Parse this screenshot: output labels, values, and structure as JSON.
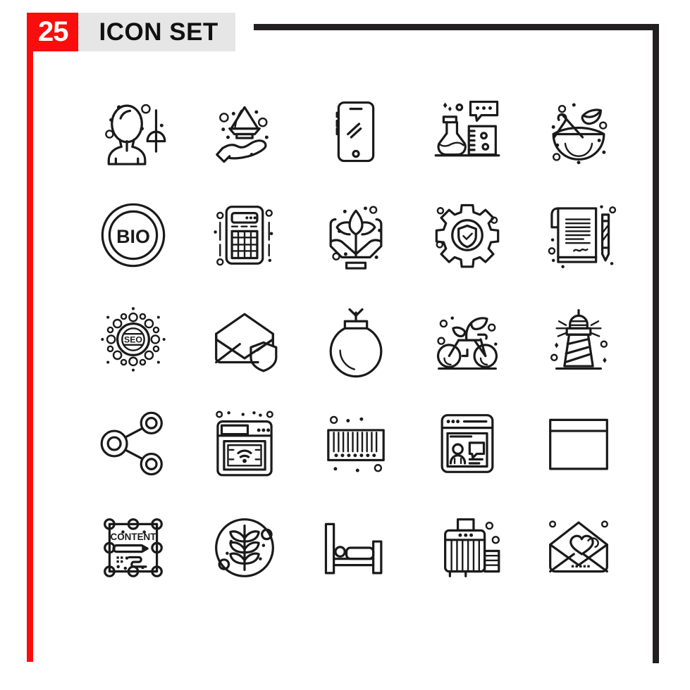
{
  "poster": {
    "count": "25",
    "title": "ICON SET",
    "accent_color": "#fb0d0d",
    "ink_color": "#231f20",
    "plate_color": "#e6e6e6",
    "background_color": "#ffffff",
    "grid_columns": 5,
    "grid_rows": 5,
    "total_icons": 25
  },
  "icons": [
    {
      "index": 1,
      "row": 1,
      "col": 1,
      "name": "user-desk-lamp-icon",
      "label": "User with desk lamp"
    },
    {
      "index": 2,
      "row": 1,
      "col": 2,
      "name": "hand-holding-gem-icon",
      "label": "Hand holding gem"
    },
    {
      "index": 3,
      "row": 1,
      "col": 3,
      "name": "smartphone-icon",
      "label": "Smartphone"
    },
    {
      "index": 4,
      "row": 1,
      "col": 4,
      "name": "lab-flask-beaker-chat-icon",
      "label": "Lab flask and beaker with chat bubble"
    },
    {
      "index": 5,
      "row": 1,
      "col": 5,
      "name": "mortar-pestle-herbs-icon",
      "label": "Mortar and pestle with herbs"
    },
    {
      "index": 6,
      "row": 2,
      "col": 1,
      "name": "bio-badge-icon",
      "label": "Bio badge",
      "text": "BIO"
    },
    {
      "index": 7,
      "row": 2,
      "col": 2,
      "name": "calculator-icon",
      "label": "Calculator"
    },
    {
      "index": 8,
      "row": 2,
      "col": 3,
      "name": "hands-holding-plant-icon",
      "label": "Hands holding plant"
    },
    {
      "index": 9,
      "row": 2,
      "col": 4,
      "name": "gear-shield-check-icon",
      "label": "Gear with security shield"
    },
    {
      "index": 10,
      "row": 2,
      "col": 5,
      "name": "contract-pen-icon",
      "label": "Signed contract with pen"
    },
    {
      "index": 11,
      "row": 3,
      "col": 1,
      "name": "seo-badge-icon",
      "label": "SEO badge",
      "text": "SEO"
    },
    {
      "index": 12,
      "row": 3,
      "col": 2,
      "name": "secure-email-shield-icon",
      "label": "Secure email with shield"
    },
    {
      "index": 13,
      "row": 3,
      "col": 3,
      "name": "bomb-icon",
      "label": "Bomb"
    },
    {
      "index": 14,
      "row": 3,
      "col": 4,
      "name": "eco-bicycle-icon",
      "label": "Eco bicycle with leaf"
    },
    {
      "index": 15,
      "row": 3,
      "col": 5,
      "name": "lighthouse-icon",
      "label": "Lighthouse"
    },
    {
      "index": 16,
      "row": 4,
      "col": 1,
      "name": "share-network-icon",
      "label": "Share network"
    },
    {
      "index": 17,
      "row": 4,
      "col": 2,
      "name": "browser-wifi-icon",
      "label": "Browser window with wifi"
    },
    {
      "index": 18,
      "row": 4,
      "col": 3,
      "name": "radiator-icon",
      "label": "Radiator"
    },
    {
      "index": 19,
      "row": 4,
      "col": 4,
      "name": "browser-webinar-icon",
      "label": "Browser window with presenter"
    },
    {
      "index": 20,
      "row": 4,
      "col": 5,
      "name": "blank-window-icon",
      "label": "Blank browser window"
    },
    {
      "index": 21,
      "row": 5,
      "col": 1,
      "name": "content-editor-icon",
      "label": "Content editing box",
      "text": "CONTENT"
    },
    {
      "index": 22,
      "row": 5,
      "col": 2,
      "name": "plant-circle-icon",
      "label": "Plant in circle"
    },
    {
      "index": 23,
      "row": 5,
      "col": 3,
      "name": "bed-icon",
      "label": "Bed"
    },
    {
      "index": 24,
      "row": 5,
      "col": 4,
      "name": "luggage-icon",
      "label": "Luggage"
    },
    {
      "index": 25,
      "row": 5,
      "col": 5,
      "name": "love-letter-icon",
      "label": "Love letter envelope"
    }
  ]
}
